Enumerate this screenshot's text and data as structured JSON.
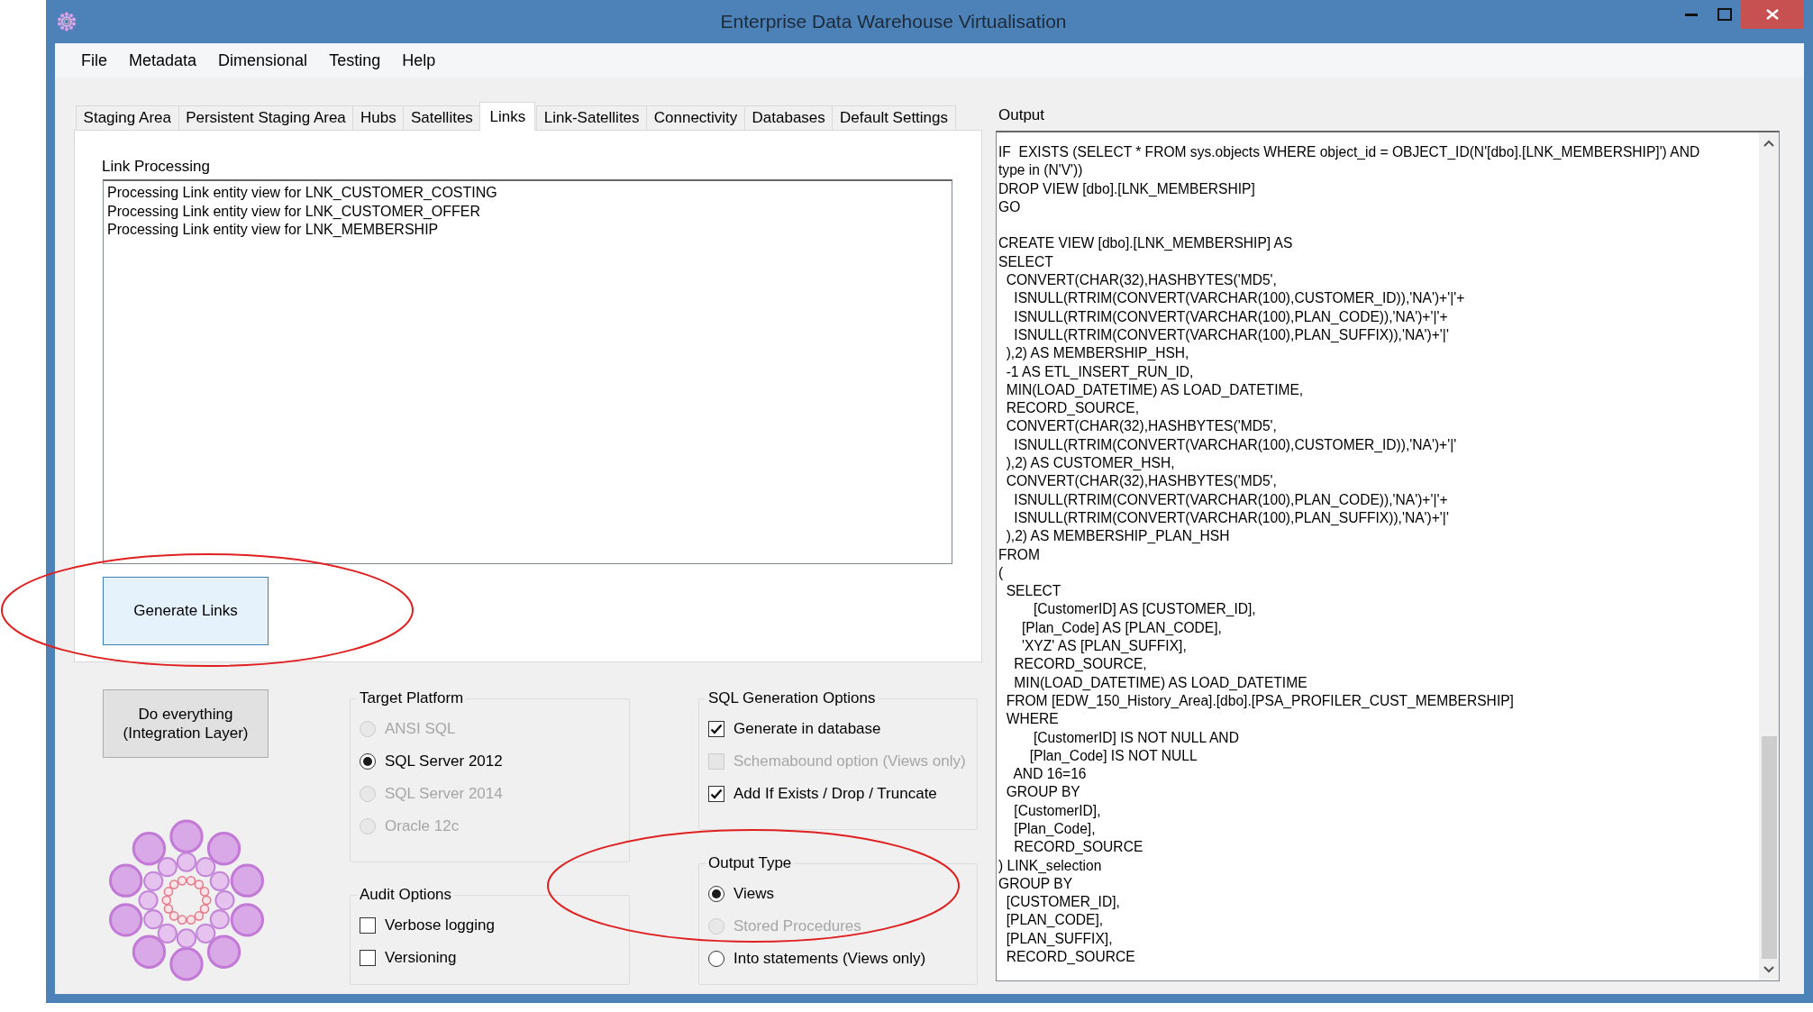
{
  "window": {
    "title": "Enterprise Data Warehouse Virtualisation"
  },
  "menu": [
    "File",
    "Metadata",
    "Dimensional",
    "Testing",
    "Help"
  ],
  "tabs": [
    {
      "label": "Staging Area",
      "selected": false
    },
    {
      "label": "Persistent Staging Area",
      "selected": false
    },
    {
      "label": "Hubs",
      "selected": false
    },
    {
      "label": "Satellites",
      "selected": false
    },
    {
      "label": "Links",
      "selected": true
    },
    {
      "label": "Link-Satellites",
      "selected": false
    },
    {
      "label": "Connectivity",
      "selected": false
    },
    {
      "label": "Databases",
      "selected": false
    },
    {
      "label": "Default Settings",
      "selected": false
    }
  ],
  "link_processing": {
    "label": "Link Processing",
    "log": [
      "Processing Link entity view for LNK_CUSTOMER_COSTING",
      "Processing Link entity view for LNK_CUSTOMER_OFFER",
      "Processing Link entity view for LNK_MEMBERSHIP"
    ],
    "button": "Generate Links"
  },
  "do_everything_button": "Do everything (Integration Layer)",
  "target_platform": {
    "title": "Target Platform",
    "kind": "radio",
    "options": [
      {
        "label": "ANSI SQL",
        "selected": false,
        "disabled": true
      },
      {
        "label": "SQL Server 2012",
        "selected": true,
        "disabled": false
      },
      {
        "label": "SQL Server 2014",
        "selected": false,
        "disabled": true
      },
      {
        "label": "Oracle 12c",
        "selected": false,
        "disabled": true
      }
    ]
  },
  "audit_options": {
    "title": "Audit Options",
    "kind": "checkbox",
    "options": [
      {
        "label": "Verbose logging",
        "checked": false,
        "disabled": false
      },
      {
        "label": "Versioning",
        "checked": false,
        "disabled": false
      }
    ]
  },
  "sql_generation_options": {
    "title": "SQL Generation Options",
    "kind": "checkbox",
    "options": [
      {
        "label": "Generate in database",
        "checked": true,
        "disabled": false
      },
      {
        "label": "Schemabound option (Views only)",
        "checked": false,
        "disabled": true
      },
      {
        "label": "Add If Exists / Drop / Truncate",
        "checked": true,
        "disabled": false
      }
    ]
  },
  "output_type": {
    "title": "Output Type",
    "kind": "radio",
    "options": [
      {
        "label": "Views",
        "selected": true,
        "disabled": false
      },
      {
        "label": "Stored Procedures",
        "selected": false,
        "disabled": true
      },
      {
        "label": "Into statements (Views only)",
        "selected": false,
        "disabled": false
      }
    ]
  },
  "output": {
    "label": "Output",
    "blocks": [
      [
        "IF  EXISTS (SELECT * FROM sys.objects WHERE object_id = OBJECT_ID(N'[dbo].[LNK_MEMBERSHIP]') AND",
        "type in (N'V'))",
        "DROP VIEW [dbo].[LNK_MEMBERSHIP]",
        "GO"
      ],
      [
        "CREATE VIEW [dbo].[LNK_MEMBERSHIP] AS",
        "SELECT",
        "  CONVERT(CHAR(32),HASHBYTES('MD5',",
        "    ISNULL(RTRIM(CONVERT(VARCHAR(100),CUSTOMER_ID)),'NA')+'|'+",
        "    ISNULL(RTRIM(CONVERT(VARCHAR(100),PLAN_CODE)),'NA')+'|'+",
        "    ISNULL(RTRIM(CONVERT(VARCHAR(100),PLAN_SUFFIX)),'NA')+'|'",
        "  ),2) AS MEMBERSHIP_HSH,",
        "  -1 AS ETL_INSERT_RUN_ID,",
        "  MIN(LOAD_DATETIME) AS LOAD_DATETIME,",
        "  RECORD_SOURCE,",
        "  CONVERT(CHAR(32),HASHBYTES('MD5',",
        "    ISNULL(RTRIM(CONVERT(VARCHAR(100),CUSTOMER_ID)),'NA')+'|'",
        "  ),2) AS CUSTOMER_HSH,",
        "  CONVERT(CHAR(32),HASHBYTES('MD5',",
        "    ISNULL(RTRIM(CONVERT(VARCHAR(100),PLAN_CODE)),'NA')+'|'+",
        "    ISNULL(RTRIM(CONVERT(VARCHAR(100),PLAN_SUFFIX)),'NA')+'|'",
        "  ),2) AS MEMBERSHIP_PLAN_HSH",
        "FROM",
        "(",
        "  SELECT",
        "         [CustomerID] AS [CUSTOMER_ID],",
        "      [Plan_Code] AS [PLAN_CODE],",
        "      'XYZ' AS [PLAN_SUFFIX],",
        "    RECORD_SOURCE,",
        "    MIN(LOAD_DATETIME) AS LOAD_DATETIME",
        "  FROM [EDW_150_History_Area].[dbo].[PSA_PROFILER_CUST_MEMBERSHIP]",
        "  WHERE",
        "         [CustomerID] IS NOT NULL AND",
        "        [Plan_Code] IS NOT NULL",
        "    AND 16=16",
        "  GROUP BY",
        "    [CustomerID],",
        "    [Plan_Code],",
        "    RECORD_SOURCE",
        ") LINK_selection",
        "GROUP BY",
        "  [CUSTOMER_ID],",
        "  [PLAN_CODE],",
        "  [PLAN_SUFFIX],",
        "  RECORD_SOURCE"
      ]
    ]
  }
}
